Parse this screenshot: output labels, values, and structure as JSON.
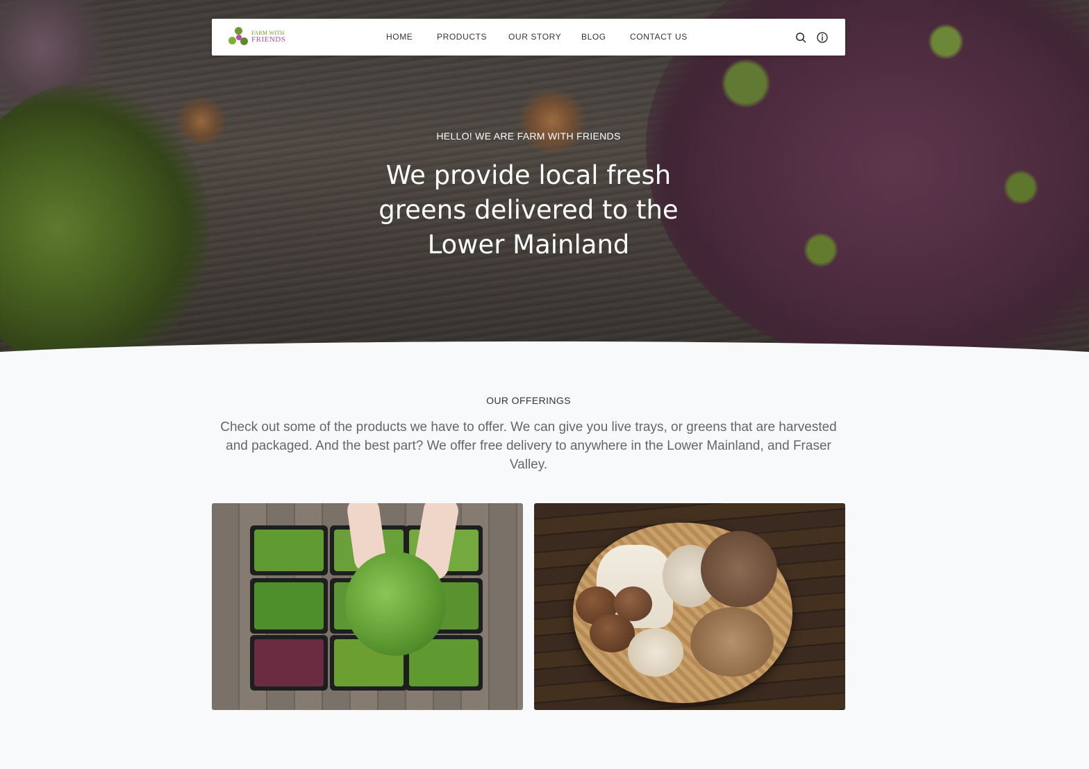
{
  "brand": {
    "logo_line1": "FARM WITH",
    "logo_line2": "FRIENDS",
    "colors": {
      "green": "#6d9a2f",
      "purple": "#b24fa8"
    }
  },
  "nav": {
    "items": [
      {
        "label": "HOME"
      },
      {
        "label": "PRODUCTS"
      },
      {
        "label": "OUR STORY"
      },
      {
        "label": "BLOG"
      },
      {
        "label": "CONTACT US"
      }
    ],
    "icons": [
      "search-icon",
      "info-icon"
    ]
  },
  "hero": {
    "eyebrow": "HELLO! WE ARE FARM WITH FRIENDS",
    "title": "We provide local fresh greens delivered to the Lower Mainland"
  },
  "offerings": {
    "label": "OUR OFFERINGS",
    "description": "Check out some of the products we have to offer. We can give you live trays, or greens that are harvested and packaged. And the best part? We offer free delivery to anywhere in the Lower Mainland, and Fraser Valley.",
    "cards": [
      {
        "image": "microgreen-trays-image"
      },
      {
        "image": "mushroom-basket-image"
      }
    ]
  }
}
